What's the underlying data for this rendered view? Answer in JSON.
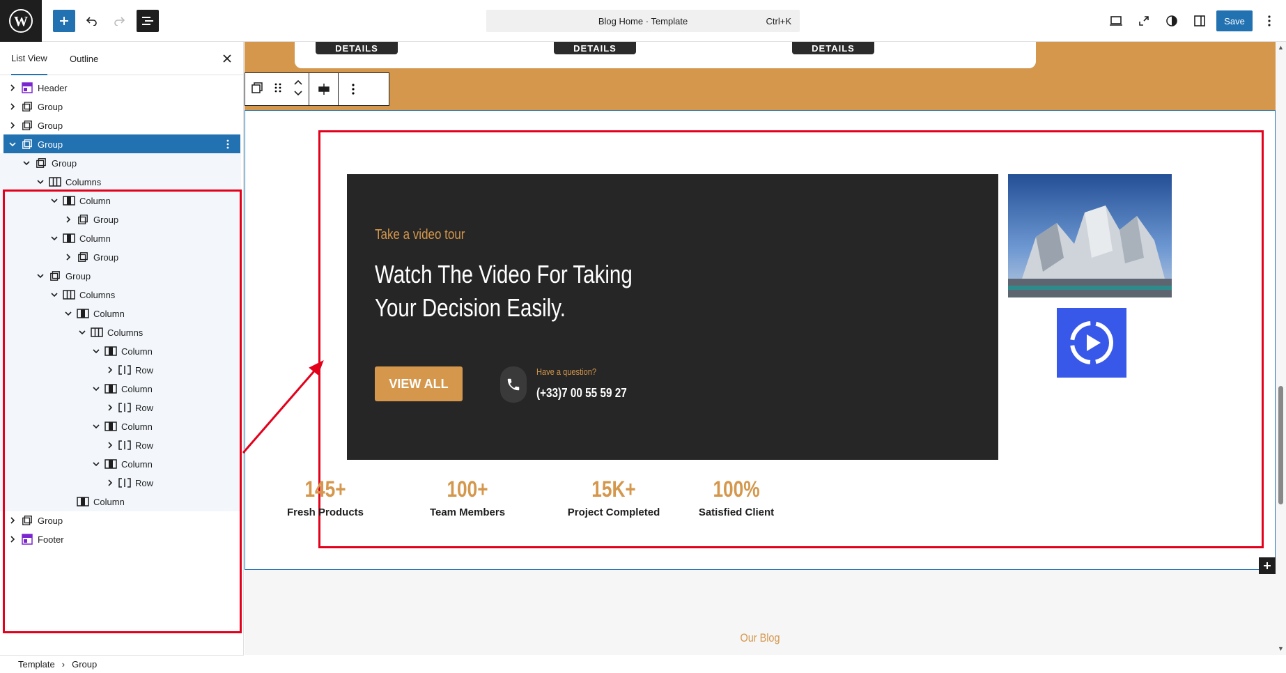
{
  "topbar": {
    "document_title": "Blog Home · Template",
    "shortcut": "Ctrl+K",
    "save_label": "Save"
  },
  "sidebar": {
    "tabs": [
      "List View",
      "Outline"
    ],
    "tree": [
      {
        "label": "Header",
        "depth": 0,
        "expanded": false,
        "type": "template-part"
      },
      {
        "label": "Group",
        "depth": 0,
        "expanded": false,
        "type": "group"
      },
      {
        "label": "Group",
        "depth": 0,
        "expanded": false,
        "type": "group"
      },
      {
        "label": "Group",
        "depth": 0,
        "expanded": true,
        "type": "group",
        "selected": true
      },
      {
        "label": "Group",
        "depth": 1,
        "expanded": true,
        "type": "group"
      },
      {
        "label": "Columns",
        "depth": 2,
        "expanded": true,
        "type": "columns"
      },
      {
        "label": "Column",
        "depth": 3,
        "expanded": true,
        "type": "column"
      },
      {
        "label": "Group",
        "depth": 4,
        "expanded": false,
        "type": "group"
      },
      {
        "label": "Column",
        "depth": 3,
        "expanded": true,
        "type": "column"
      },
      {
        "label": "Group",
        "depth": 4,
        "expanded": false,
        "type": "group"
      },
      {
        "label": "Group",
        "depth": 2,
        "expanded": true,
        "type": "group"
      },
      {
        "label": "Columns",
        "depth": 3,
        "expanded": true,
        "type": "columns"
      },
      {
        "label": "Column",
        "depth": 4,
        "expanded": true,
        "type": "column"
      },
      {
        "label": "Columns",
        "depth": 5,
        "expanded": true,
        "type": "columns"
      },
      {
        "label": "Column",
        "depth": 6,
        "expanded": true,
        "type": "column"
      },
      {
        "label": "Row",
        "depth": 7,
        "expanded": false,
        "type": "row"
      },
      {
        "label": "Column",
        "depth": 6,
        "expanded": true,
        "type": "column"
      },
      {
        "label": "Row",
        "depth": 7,
        "expanded": false,
        "type": "row"
      },
      {
        "label": "Column",
        "depth": 6,
        "expanded": true,
        "type": "column"
      },
      {
        "label": "Row",
        "depth": 7,
        "expanded": false,
        "type": "row"
      },
      {
        "label": "Column",
        "depth": 6,
        "expanded": true,
        "type": "column"
      },
      {
        "label": "Row",
        "depth": 7,
        "expanded": false,
        "type": "row"
      },
      {
        "label": "Column",
        "depth": 4,
        "expanded": null,
        "type": "column"
      },
      {
        "label": "Group",
        "depth": 0,
        "expanded": false,
        "type": "group"
      },
      {
        "label": "Footer",
        "depth": 0,
        "expanded": false,
        "type": "template-part"
      }
    ]
  },
  "breadcrumb": [
    "Template",
    "Group"
  ],
  "canvas": {
    "card_button_label": "DETAILS",
    "video": {
      "subtitle": "Take a video tour",
      "heading_line1": "Watch The Video For Taking",
      "heading_line2": "Your Decision Easily.",
      "button_label": "VIEW ALL",
      "question": "Have a question?",
      "phone": "(+33)7 00 55 59 27"
    },
    "stats": [
      {
        "number": "145+",
        "label": "Fresh Products"
      },
      {
        "number": "100+",
        "label": "Team Members"
      },
      {
        "number": "15K+",
        "label": "Project Completed"
      },
      {
        "number": "100%",
        "label": "Satisfied Client"
      }
    ],
    "blog_label": "Our Blog"
  },
  "colors": {
    "accent": "#d4974c",
    "dark": "#262626",
    "wp_blue": "#2271b1",
    "play_blue": "#3858e9",
    "highlight_red": "#e3001b"
  }
}
